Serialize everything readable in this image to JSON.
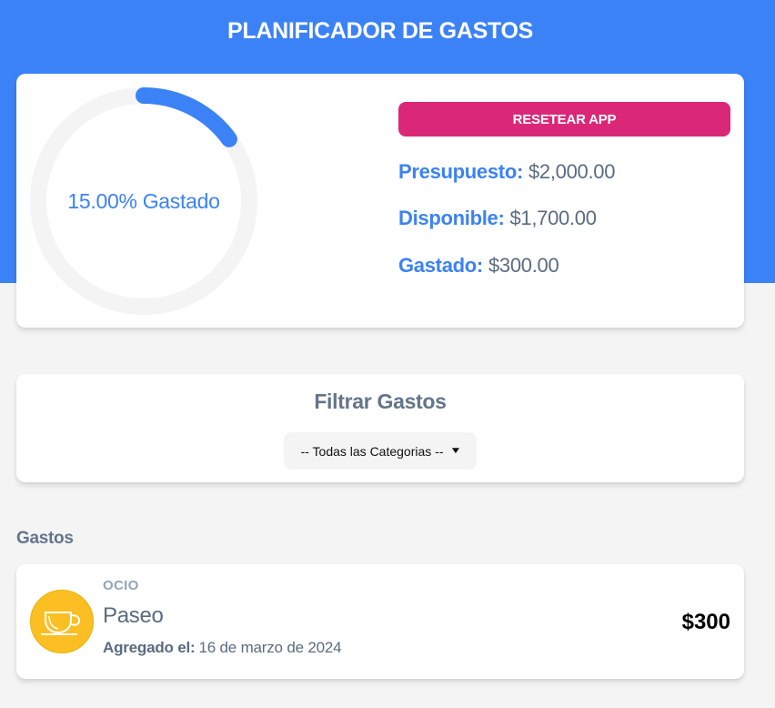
{
  "header": {
    "title": "PLANIFICADOR DE GASTOS"
  },
  "budget": {
    "progress_label": "15.00% Gastado",
    "progress_fraction": 0.15,
    "reset_button": "RESETEAR APP",
    "budget_label": "Presupuesto:",
    "budget_value": "$2,000.00",
    "available_label": "Disponible:",
    "available_value": "$1,700.00",
    "spent_label": "Gastado:",
    "spent_value": "$300.00"
  },
  "filter": {
    "title": "Filtrar Gastos",
    "selected_option": "-- Todas las Categorias --"
  },
  "expenses": {
    "title": "Gastos",
    "items": [
      {
        "category": "OCIO",
        "name": "Paseo",
        "date_label": "Agregado el:",
        "date": "16 de marzo de 2024",
        "amount": "$300",
        "icon": "coffee-cup-icon"
      }
    ]
  },
  "colors": {
    "primary": "#3b82f6",
    "accent": "#db2777",
    "background": "#f4f4f4",
    "category_icon_bg": "#fbbf24"
  }
}
